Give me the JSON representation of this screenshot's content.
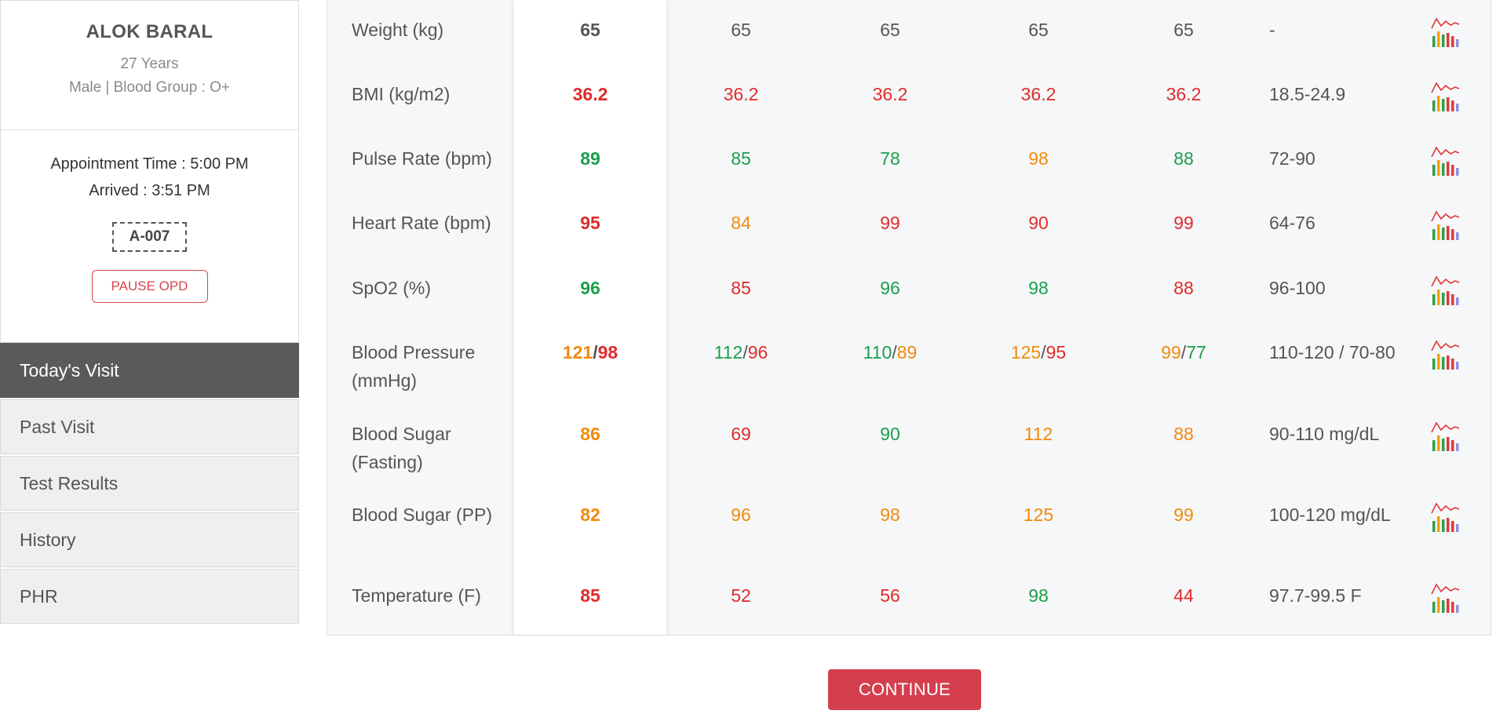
{
  "patient": {
    "name": "ALOK BARAL",
    "age": "27 Years",
    "gender_blood": "Male | Blood Group : O+"
  },
  "appointment": {
    "time": "Appointment Time : 5:00 PM",
    "arrived": "Arrived : 3:51 PM",
    "token": "A-007",
    "pause_label": "PAUSE OPD"
  },
  "nav": {
    "items": [
      {
        "label": "Today's Visit",
        "active": true
      },
      {
        "label": "Past Visit",
        "active": false
      },
      {
        "label": "Test Results",
        "active": false
      },
      {
        "label": "History",
        "active": false
      },
      {
        "label": "PHR",
        "active": false
      }
    ]
  },
  "colors": {
    "normal": "#555555",
    "high": "#e02b2b",
    "good": "#1b9e4b",
    "warn": "#f28a0c",
    "accent": "#d53f4d"
  },
  "vitals": {
    "rows": [
      {
        "label": "Weight (kg)",
        "values": [
          [
            [
              "65",
              "normal"
            ]
          ],
          [
            [
              "65",
              "normal"
            ]
          ],
          [
            [
              "65",
              "normal"
            ]
          ],
          [
            [
              "65",
              "normal"
            ]
          ],
          [
            [
              "65",
              "normal"
            ]
          ]
        ],
        "range": "-"
      },
      {
        "label": "BMI (kg/m2)",
        "values": [
          [
            [
              "36.2",
              "high"
            ]
          ],
          [
            [
              "36.2",
              "high"
            ]
          ],
          [
            [
              "36.2",
              "high"
            ]
          ],
          [
            [
              "36.2",
              "high"
            ]
          ],
          [
            [
              "36.2",
              "high"
            ]
          ]
        ],
        "range": "18.5-24.9"
      },
      {
        "label": "Pulse Rate (bpm)",
        "values": [
          [
            [
              "89",
              "good"
            ]
          ],
          [
            [
              "85",
              "good"
            ]
          ],
          [
            [
              "78",
              "good"
            ]
          ],
          [
            [
              "98",
              "warn"
            ]
          ],
          [
            [
              "88",
              "good"
            ]
          ]
        ],
        "range": "72-90"
      },
      {
        "label": "Heart Rate (bpm)",
        "values": [
          [
            [
              "95",
              "high"
            ]
          ],
          [
            [
              "84",
              "warn"
            ]
          ],
          [
            [
              "99",
              "high"
            ]
          ],
          [
            [
              "90",
              "high"
            ]
          ],
          [
            [
              "99",
              "high"
            ]
          ]
        ],
        "range": "64-76"
      },
      {
        "label": "SpO2 (%)",
        "values": [
          [
            [
              "96",
              "good"
            ]
          ],
          [
            [
              "85",
              "high"
            ]
          ],
          [
            [
              "96",
              "good"
            ]
          ],
          [
            [
              "98",
              "good"
            ]
          ],
          [
            [
              "88",
              "high"
            ]
          ]
        ],
        "range": "96-100"
      },
      {
        "label": "Blood Pressure (mmHg)",
        "values": [
          [
            [
              "121",
              "warn"
            ],
            [
              "98",
              "high"
            ]
          ],
          [
            [
              "112",
              "good"
            ],
            [
              "96",
              "high"
            ]
          ],
          [
            [
              "110",
              "good"
            ],
            [
              "89",
              "warn"
            ]
          ],
          [
            [
              "125",
              "warn"
            ],
            [
              "95",
              "high"
            ]
          ],
          [
            [
              "99",
              "warn"
            ],
            [
              "77",
              "good"
            ]
          ]
        ],
        "range": "110-120 / 70-80"
      },
      {
        "label": "Blood Sugar (Fasting)",
        "values": [
          [
            [
              "86",
              "warn"
            ]
          ],
          [
            [
              "69",
              "high"
            ]
          ],
          [
            [
              "90",
              "good"
            ]
          ],
          [
            [
              "112",
              "warn"
            ]
          ],
          [
            [
              "88",
              "warn"
            ]
          ]
        ],
        "range": "90-110 mg/dL"
      },
      {
        "label": "Blood Sugar (PP)",
        "values": [
          [
            [
              "82",
              "warn"
            ]
          ],
          [
            [
              "96",
              "warn"
            ]
          ],
          [
            [
              "98",
              "warn"
            ]
          ],
          [
            [
              "125",
              "warn"
            ]
          ],
          [
            [
              "99",
              "warn"
            ]
          ]
        ],
        "range": "100-120 mg/dL"
      },
      {
        "label": "Temperature (F)",
        "values": [
          [
            [
              "85",
              "high"
            ]
          ],
          [
            [
              "52",
              "high"
            ]
          ],
          [
            [
              "56",
              "high"
            ]
          ],
          [
            [
              "98",
              "good"
            ]
          ],
          [
            [
              "44",
              "high"
            ]
          ]
        ],
        "range": "97.7-99.5 F"
      }
    ]
  },
  "actions": {
    "continue_label": "CONTINUE"
  }
}
